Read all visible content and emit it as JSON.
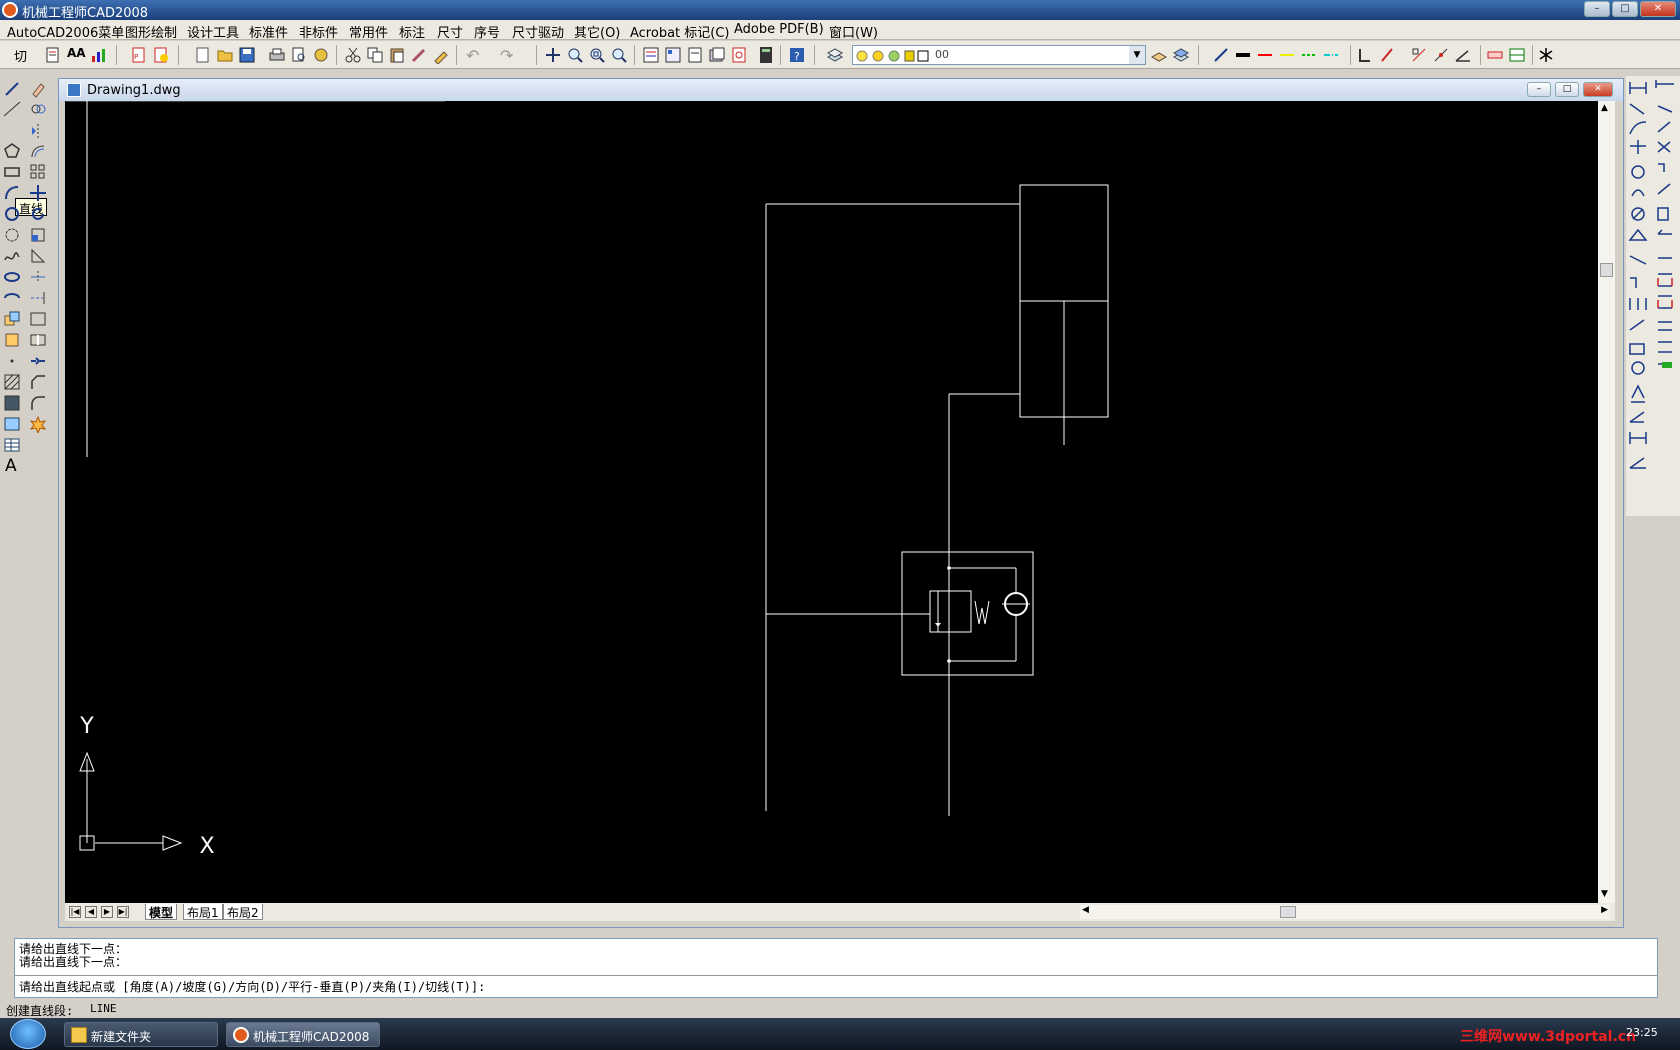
{
  "app": {
    "title": "机械工程师CAD2008"
  },
  "menu": {
    "items": [
      "AutoCAD2006菜单",
      "图形绘制",
      "设计工具",
      "标准件",
      "非标件",
      "常用件",
      "标注",
      "尺寸",
      "序号",
      "尺寸驱动",
      "其它(O)",
      "Acrobat 标记(C)",
      "Adobe PDF(B)",
      "窗口(W)"
    ]
  },
  "toolbar": {
    "first_label": "切",
    "text_style": "AA",
    "layer_name": "00"
  },
  "tooltip": {
    "text": "直线"
  },
  "document": {
    "filename": "Drawing1.dwg"
  },
  "canvas": {
    "ucs_y": "Y",
    "ucs_x": "X",
    "spring_label": "W"
  },
  "tabs": {
    "model": "模型",
    "layout1": "布局1",
    "layout2": "布局2"
  },
  "command": {
    "history": [
      "请给出直线下一点：",
      "请给出直线下一点："
    ],
    "prompt": "请给出直线起点或 [角度(A)/坡度(G)/方向(D)/平行-垂直(P)/夹角(I)/切线(T)]:"
  },
  "status": {
    "label": "创建直线段:",
    "command": "LINE"
  },
  "taskbar": {
    "items": [
      "新建文件夹",
      "机械工程师CAD2008"
    ],
    "watermark": "三维网www.3dportal.cn",
    "clock": "23:25"
  }
}
